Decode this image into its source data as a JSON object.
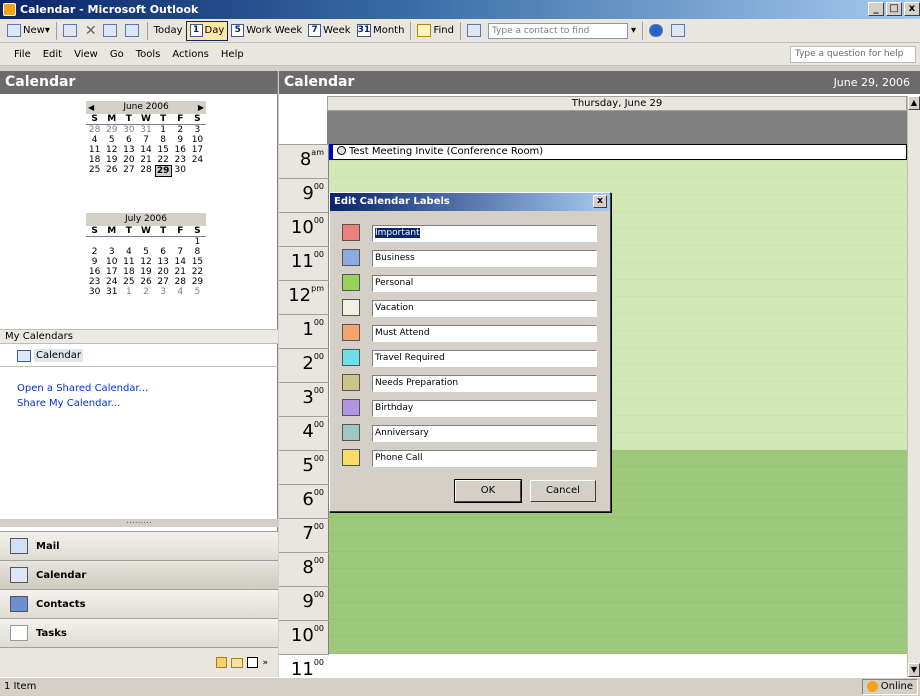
{
  "window": {
    "title": "Calendar - Microsoft Outlook",
    "controls": [
      "_",
      "□",
      "x"
    ]
  },
  "toolbar": {
    "new": "New",
    "today": "Today",
    "day": {
      "num": "1",
      "label": "Day"
    },
    "workweek": {
      "num": "5",
      "label": "Work Week"
    },
    "week": {
      "num": "7",
      "label": "Week"
    },
    "month": {
      "num": "31",
      "label": "Month"
    },
    "find": "Find",
    "contact_placeholder": "Type a contact to find"
  },
  "menu": [
    "File",
    "Edit",
    "View",
    "Go",
    "Tools",
    "Actions",
    "Help"
  ],
  "question_placeholder": "Type a question for help",
  "nav": {
    "header": "Calendar",
    "june": {
      "title": "June 2006",
      "days": [
        "S",
        "M",
        "T",
        "W",
        "T",
        "F",
        "S"
      ],
      "cells": [
        "28",
        "29",
        "30",
        "31",
        "1",
        "2",
        "3",
        "4",
        "5",
        "6",
        "7",
        "8",
        "9",
        "10",
        "11",
        "12",
        "13",
        "14",
        "15",
        "16",
        "17",
        "18",
        "19",
        "20",
        "21",
        "22",
        "23",
        "24",
        "25",
        "26",
        "27",
        "28",
        "29",
        "30",
        ""
      ],
      "today": "29"
    },
    "july": {
      "title": "July 2006",
      "days": [
        "S",
        "M",
        "T",
        "W",
        "T",
        "F",
        "S"
      ],
      "cells": [
        "",
        "",
        "",
        "",
        "",
        "",
        "1",
        "2",
        "3",
        "4",
        "5",
        "6",
        "7",
        "8",
        "9",
        "10",
        "11",
        "12",
        "13",
        "14",
        "15",
        "16",
        "17",
        "18",
        "19",
        "20",
        "21",
        "22",
        "23",
        "24",
        "25",
        "26",
        "27",
        "28",
        "29",
        "30",
        "31",
        "1",
        "2",
        "3",
        "4",
        "5"
      ]
    },
    "my_calendars": "My Calendars",
    "calendar_item": "Calendar",
    "links": [
      "Open a Shared Calendar...",
      "Share My Calendar..."
    ],
    "grip": ".........",
    "buttons": [
      "Mail",
      "Calendar",
      "Contacts",
      "Tasks"
    ]
  },
  "main": {
    "header": "Calendar",
    "date": "June 29, 2006",
    "day_header": "Thursday, June 29",
    "hours": [
      {
        "h": "8",
        "m": "am"
      },
      {
        "h": "9",
        "m": "00"
      },
      {
        "h": "10",
        "m": "00"
      },
      {
        "h": "11",
        "m": "00"
      },
      {
        "h": "12",
        "m": "pm"
      },
      {
        "h": "1",
        "m": "00"
      },
      {
        "h": "2",
        "m": "00"
      },
      {
        "h": "3",
        "m": "00"
      },
      {
        "h": "4",
        "m": "00"
      },
      {
        "h": "5",
        "m": "00"
      },
      {
        "h": "6",
        "m": "00"
      },
      {
        "h": "7",
        "m": "00"
      },
      {
        "h": "8",
        "m": "00"
      },
      {
        "h": "9",
        "m": "00"
      },
      {
        "h": "10",
        "m": "00"
      },
      {
        "h": "11",
        "m": "00"
      }
    ],
    "appointment": "Test Meeting Invite (Conference Room)"
  },
  "dialog": {
    "title": "Edit Calendar Labels",
    "close": "x",
    "labels": [
      {
        "name": "Important",
        "color": "#f08080"
      },
      {
        "name": "Business",
        "color": "#8ea9e0"
      },
      {
        "name": "Personal",
        "color": "#99d15c"
      },
      {
        "name": "Vacation",
        "color": "#f2f0e0"
      },
      {
        "name": "Must Attend",
        "color": "#f7a66b"
      },
      {
        "name": "Travel Required",
        "color": "#6be0ea"
      },
      {
        "name": "Needs Preparation",
        "color": "#cdc48a"
      },
      {
        "name": "Birthday",
        "color": "#b493e2"
      },
      {
        "name": "Anniversary",
        "color": "#9ec7c0"
      },
      {
        "name": "Phone Call",
        "color": "#f7dd66"
      }
    ],
    "ok": "OK",
    "cancel": "Cancel"
  },
  "status": {
    "left": "1 Item",
    "right": "Online"
  }
}
